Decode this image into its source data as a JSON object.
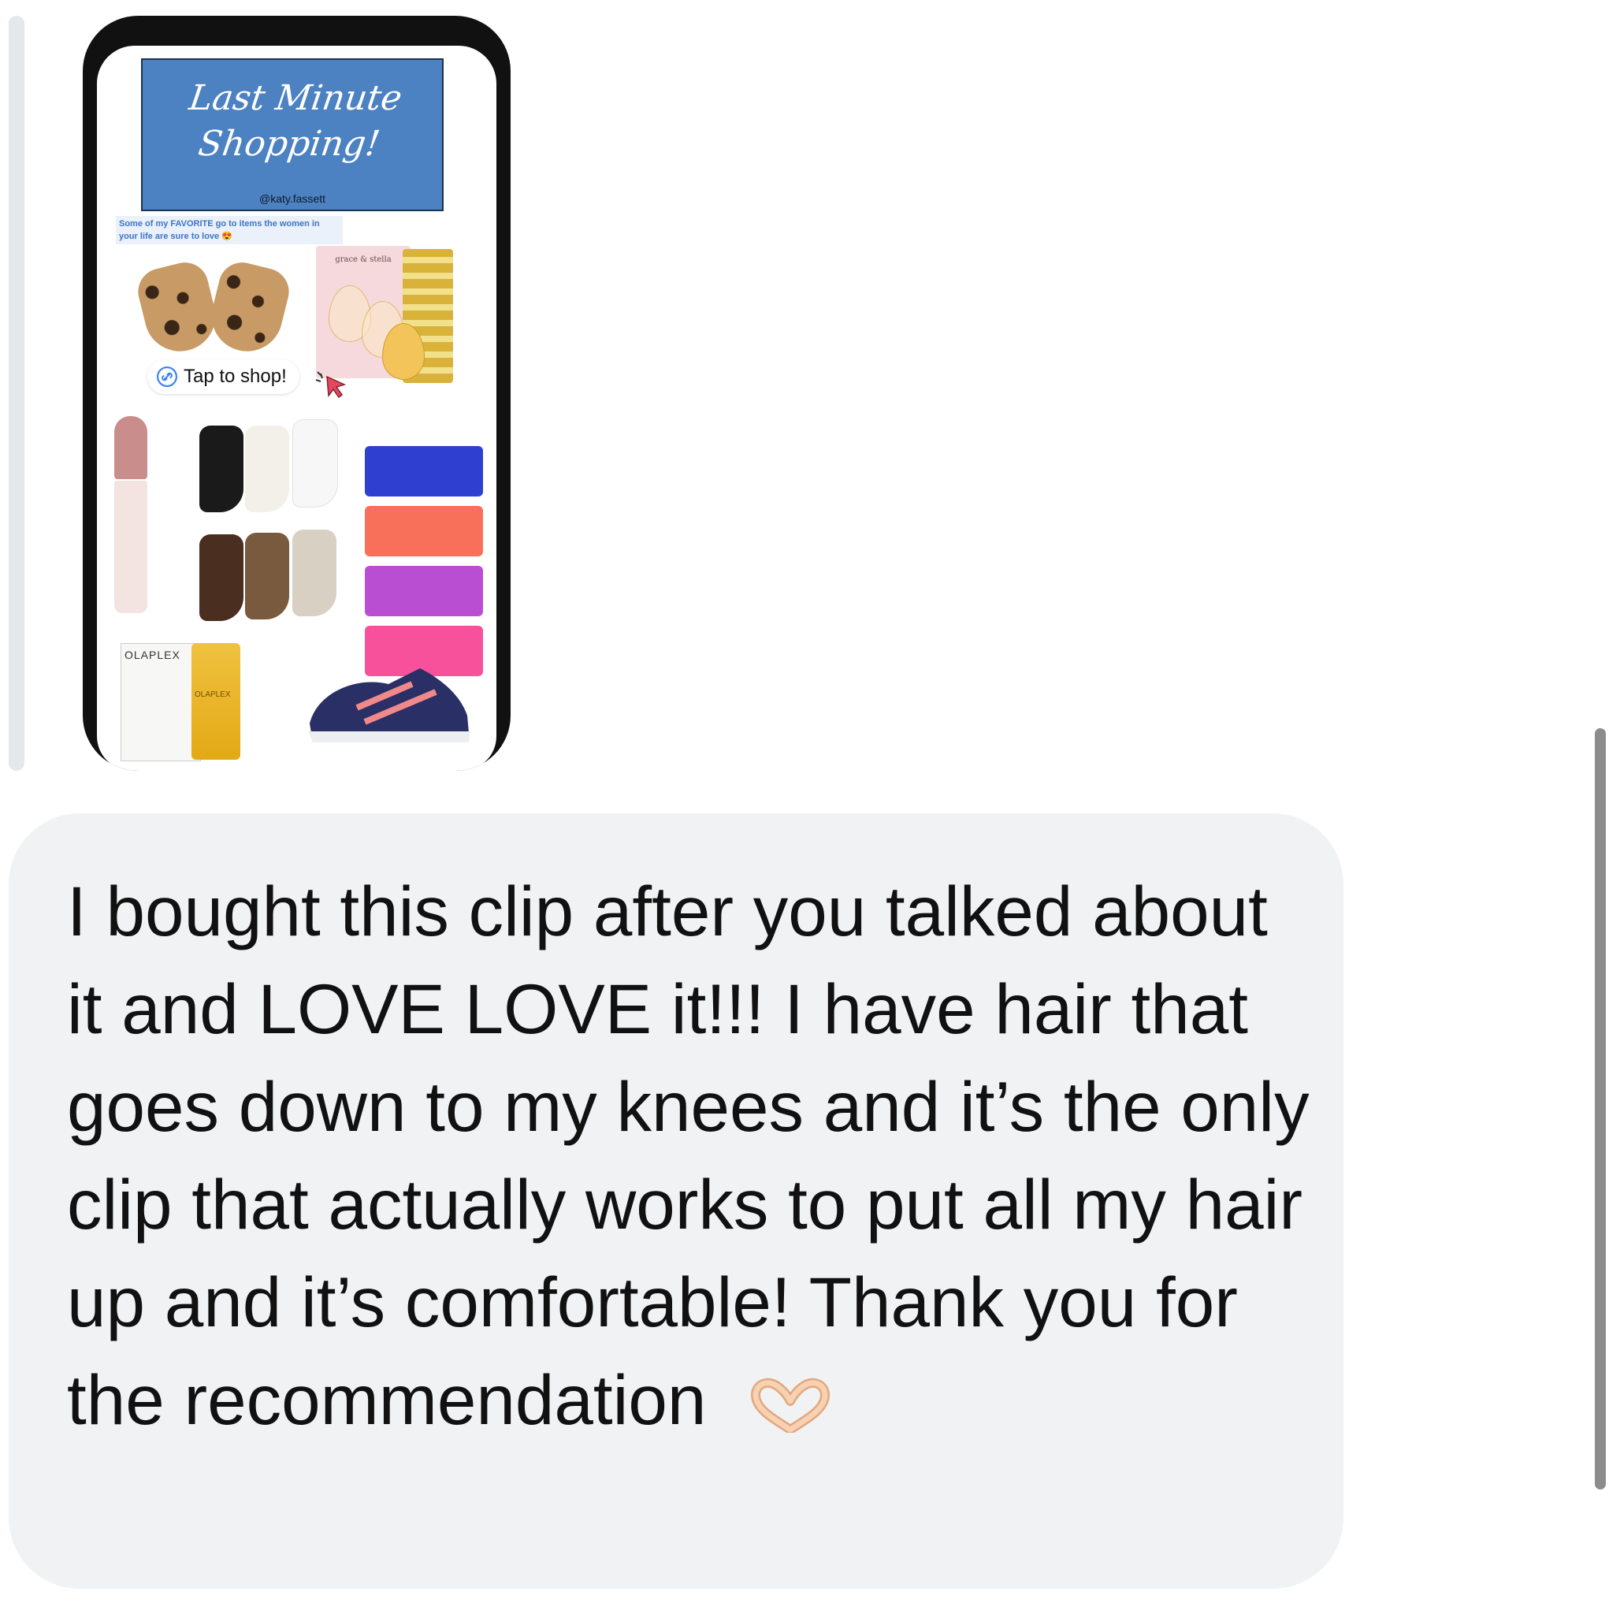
{
  "story": {
    "banner_title_line1": "Last Minute",
    "banner_title_line2": "Shopping!",
    "handle": "@katy.fassett",
    "subtitle": "Some of my FAVORITE go to items the women in your life are sure to love 😍",
    "product_label_eye_masks": "grace & stella",
    "product_label_olaplex": "OLAPLEX",
    "tap_to_shop": "Tap to shop!"
  },
  "message": {
    "text": "I bought this clip after you talked about it and LOVE LOVE it!!! I have hair that goes down to my knees and it’s the only clip that actually works to put all my hair up and it’s comfortable! Thank you for the recommendation",
    "emoji": "heart-hands"
  },
  "colors": {
    "bubble_bg": "#f1f2f4",
    "banner_bg": "#4c81c2",
    "reply_bar": "#e6e7eb"
  }
}
